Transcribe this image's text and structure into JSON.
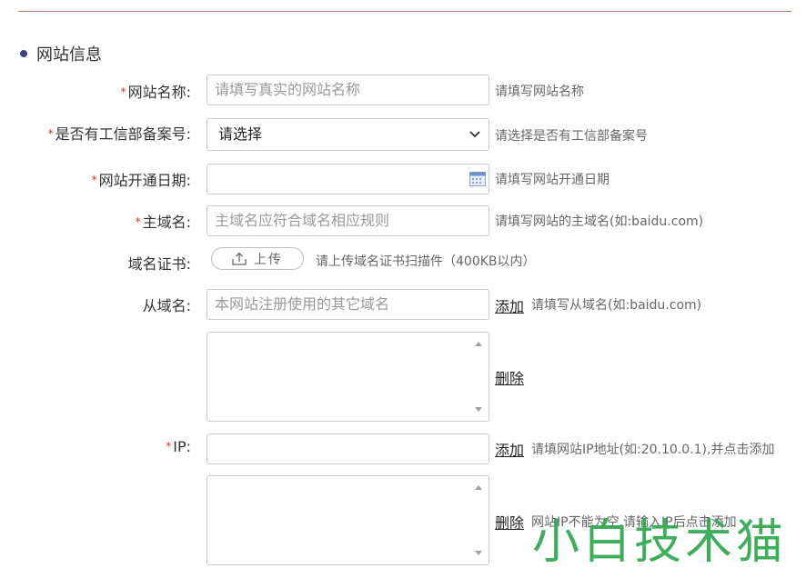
{
  "section": {
    "title": "网站信息"
  },
  "form": {
    "site_name": {
      "label": "网站名称:",
      "placeholder": "请填写真实的网站名称",
      "hint": "请填写网站名称"
    },
    "miit_record": {
      "label": "是否有工信部备案号:",
      "selected": "请选择",
      "hint": "请选择是否有工信部备案号"
    },
    "open_date": {
      "label": "网站开通日期:",
      "value": "",
      "hint": "请填写网站开通日期"
    },
    "main_domain": {
      "label": "主域名:",
      "placeholder": "主域名应符合域名相应规则",
      "hint": "请填写网站的主域名(如:baidu.com)"
    },
    "domain_cert": {
      "label": "域名证书:",
      "button": "上传",
      "hint": "请上传域名证书扫描件（400KB以内）"
    },
    "sub_domain": {
      "label": "从域名:",
      "placeholder": "本网站注册使用的其它域名",
      "add": "添加",
      "hint": "请填写从域名(如:baidu.com)",
      "delete": "删除"
    },
    "ip": {
      "label": "IP:",
      "value": "",
      "add": "添加",
      "hint": "请填网站IP地址(如:20.10.0.1),并点击添加",
      "delete": "删除",
      "delete_hint": "网站IP不能为空,请输入IP后点击添加"
    }
  },
  "required_mark": "*",
  "watermark": "小白技术猫",
  "colors": {
    "required": "#d9321f",
    "bullet": "#3b3f8c",
    "rule": "#b7705a",
    "watermark": "#2fa84f"
  }
}
